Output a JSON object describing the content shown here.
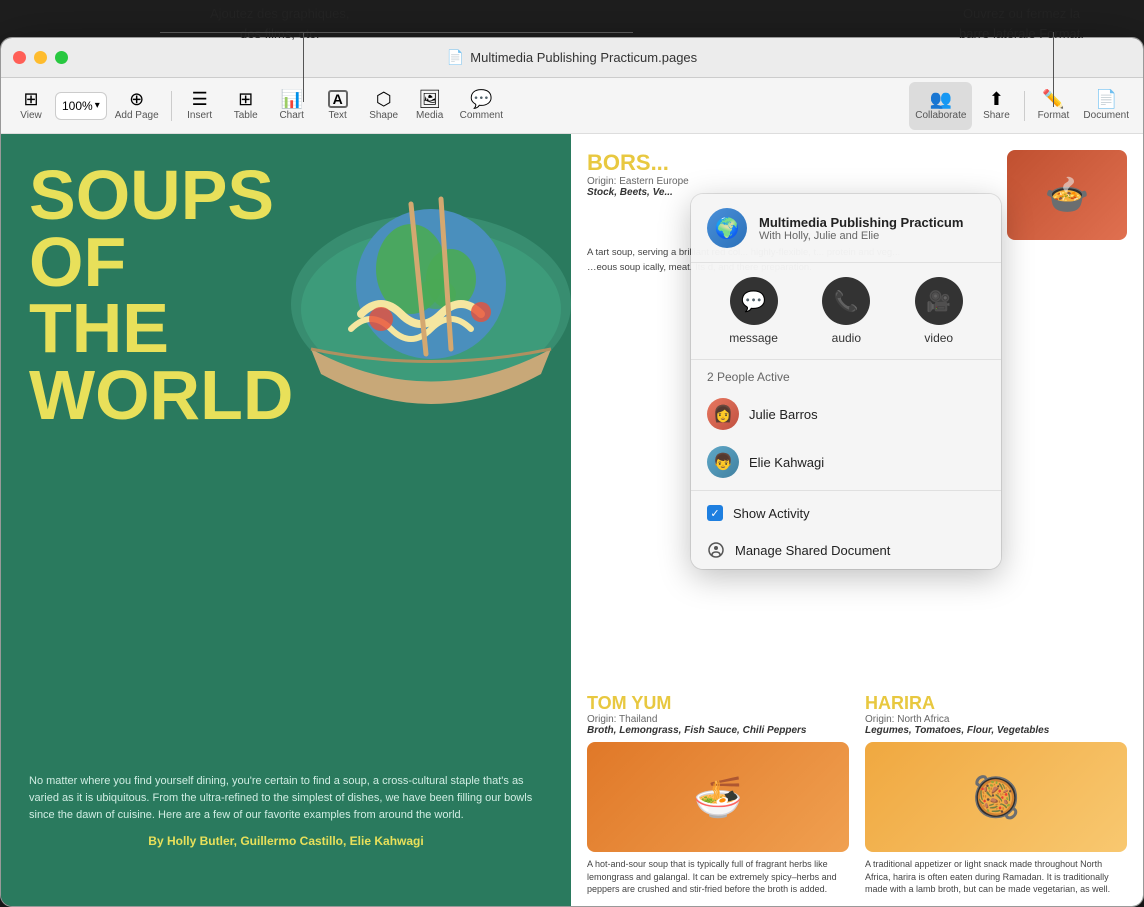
{
  "annotations": {
    "left_text_line1": "Ajoutez des graphiques,",
    "left_text_line2": "des films, etc.",
    "right_text_line1": "Ouvrez ou fermez la",
    "right_text_line2": "barre latérale Format."
  },
  "titlebar": {
    "title": "Multimedia Publishing Practicum.pages",
    "icon": "📄"
  },
  "toolbar": {
    "view_label": "View",
    "zoom_value": "100%",
    "add_page_label": "Add Page",
    "insert_label": "Insert",
    "table_label": "Table",
    "chart_label": "Chart",
    "text_label": "Text",
    "shape_label": "Shape",
    "media_label": "Media",
    "comment_label": "Comment",
    "collaborate_label": "Collaborate",
    "share_label": "Share",
    "format_label": "Format",
    "document_label": "Document"
  },
  "soup_page": {
    "title_line1": "SOUPS",
    "title_line2": "OF",
    "title_line3": "THE",
    "title_line4": "WORLD",
    "body_text": "No matter where you find yourself dining, you're certain to find a soup, a cross-cultural staple that's as varied as it is ubiquitous. From the ultra-refined to the simplest of dishes, we have been filling our bowls since the dawn of cuisine. Here are a few of our favorite examples from around the world.",
    "author": "By Holly Butler, Guillermo Castillo, Elie Kahwagi"
  },
  "recipes": {
    "borsch": {
      "title": "BORSCH",
      "origin": "Origin: Eastern Europe",
      "ingredients": "Stock, Beets, Ve...",
      "desc": "A tart soup, served... brilliant red col... highly-flexible, t... protein and veg..."
    },
    "tom_yum": {
      "title": "TOM YUM",
      "origin": "Origin: Thailand",
      "ingredients": "Broth, Lemongrass, Fish Sauce, Chili Peppers",
      "desc": "A hot-and-sour soup that is typically full of fragrant herbs like lemongrass and galangal. It can be extremely spicy–herbs and peppers are crushed and stir-fried before the broth is added."
    },
    "harira": {
      "title": "HARIRA",
      "origin": "Origin: North Africa",
      "ingredients": "Legumes, Tomatoes, Flour, Vegetables",
      "desc": "A traditional appetizer or light snack made throughout North Africa, harira is often eaten during Ramadan. It is traditionally made with a lamb broth, but can be made vegetarian, as well."
    }
  },
  "collab_popup": {
    "doc_title": "Multimedia Publishing Practicum",
    "doc_subtitle": "With Holly, Julie and Elie",
    "message_label": "message",
    "audio_label": "audio",
    "video_label": "video",
    "people_count": "2 People Active",
    "person1": "Julie Barros",
    "person2": "Elie Kahwagi",
    "show_activity_label": "Show Activity",
    "manage_label": "Manage Shared Document"
  }
}
